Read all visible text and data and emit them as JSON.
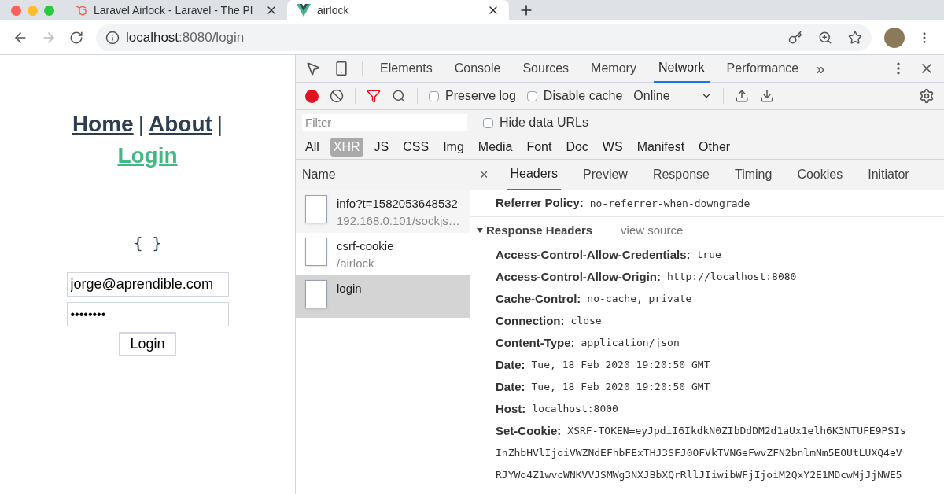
{
  "browser": {
    "tabs": [
      {
        "title": "Laravel Airlock - Laravel - The Pl",
        "selected": false
      },
      {
        "title": "airlock",
        "selected": true
      }
    ],
    "url_host": "localhost",
    "url_rest": ":8080/login"
  },
  "page": {
    "nav": [
      {
        "label": "Home",
        "selected": false,
        "separator": "|"
      },
      {
        "label": "About",
        "selected": false,
        "separator": "|"
      },
      {
        "label": "Login",
        "selected": true
      }
    ],
    "output": "{ }",
    "email": "jorge@aprendible.com",
    "password": "••••••••",
    "button": "Login"
  },
  "devtools": {
    "tabs": [
      {
        "label": "Elements",
        "selected": false
      },
      {
        "label": "Console",
        "selected": false
      },
      {
        "label": "Sources",
        "selected": false
      },
      {
        "label": "Memory",
        "selected": false
      },
      {
        "label": "Network",
        "selected": true
      },
      {
        "label": "Performance",
        "selected": false
      }
    ],
    "more": "»",
    "preserve_log": {
      "label": "Preserve log",
      "checked": false
    },
    "disable_cache": {
      "label": "Disable cache",
      "checked": false
    },
    "throttle": "Online",
    "filter": {
      "placeholder": "Filter"
    },
    "hide_data_urls": {
      "label": "Hide data URLs",
      "checked": false
    },
    "types": [
      {
        "label": "All",
        "selected": false
      },
      {
        "label": "XHR",
        "selected": true
      },
      {
        "label": "JS",
        "selected": false
      },
      {
        "label": "CSS",
        "selected": false
      },
      {
        "label": "Img",
        "selected": false
      },
      {
        "label": "Media",
        "selected": false
      },
      {
        "label": "Font",
        "selected": false
      },
      {
        "label": "Doc",
        "selected": false
      },
      {
        "label": "WS",
        "selected": false
      },
      {
        "label": "Manifest",
        "selected": false
      },
      {
        "label": "Other",
        "selected": false
      }
    ],
    "name_header": "Name",
    "requests": [
      {
        "name": "info?t=1582053648532",
        "path": "192.168.0.101/sockjs…",
        "selected": false
      },
      {
        "name": "csrf-cookie",
        "path": "/airlock",
        "selected": false
      },
      {
        "name": "login",
        "selected": true
      }
    ],
    "detail_close": "×",
    "detail_tabs": [
      {
        "label": "Headers",
        "selected": true
      },
      {
        "label": "Preview",
        "selected": false
      },
      {
        "label": "Response",
        "selected": false
      },
      {
        "label": "Timing",
        "selected": false
      },
      {
        "label": "Cookies",
        "selected": false
      },
      {
        "label": "Initiator",
        "selected": false
      }
    ],
    "referrer": {
      "key": "Referrer Policy:",
      "value": "no-referrer-when-downgrade"
    },
    "section": {
      "title": "Response Headers",
      "link": "view source",
      "expanded": true
    },
    "headers": [
      {
        "key": "Access-Control-Allow-Credentials:",
        "value": "true"
      },
      {
        "key": "Access-Control-Allow-Origin:",
        "value": "http://localhost:8080"
      },
      {
        "key": "Cache-Control:",
        "value": "no-cache, private"
      },
      {
        "key": "Connection:",
        "value": "close"
      },
      {
        "key": "Content-Type:",
        "value": "application/json"
      },
      {
        "key": "Date:",
        "value": "Tue, 18 Feb 2020 19:20:50 GMT"
      },
      {
        "key": "Date:",
        "value": "Tue, 18 Feb 2020 19:20:50 GMT"
      },
      {
        "key": "Host:",
        "value": "localhost:8000"
      },
      {
        "key": "Set-Cookie:",
        "value": "XSRF-TOKEN=eyJpdiI6IkdkN0ZIbDdDM2d1aUx1elh6K3NTUFE9PSIs"
      }
    ],
    "continuation": [
      "InZhbHVlIjoiVWZNdEFhbFExTHJ3SFJ0OFVkTVNGeFwvZFN2bnlmNm5EOUtLUXQ4eV",
      "RJYWo4Z1wvcWNKVVJSMWg3NXJBbXQrRllJIiwibWFjIjoiM2QxY2E1MDcwMjJjNWE5"
    ]
  }
}
